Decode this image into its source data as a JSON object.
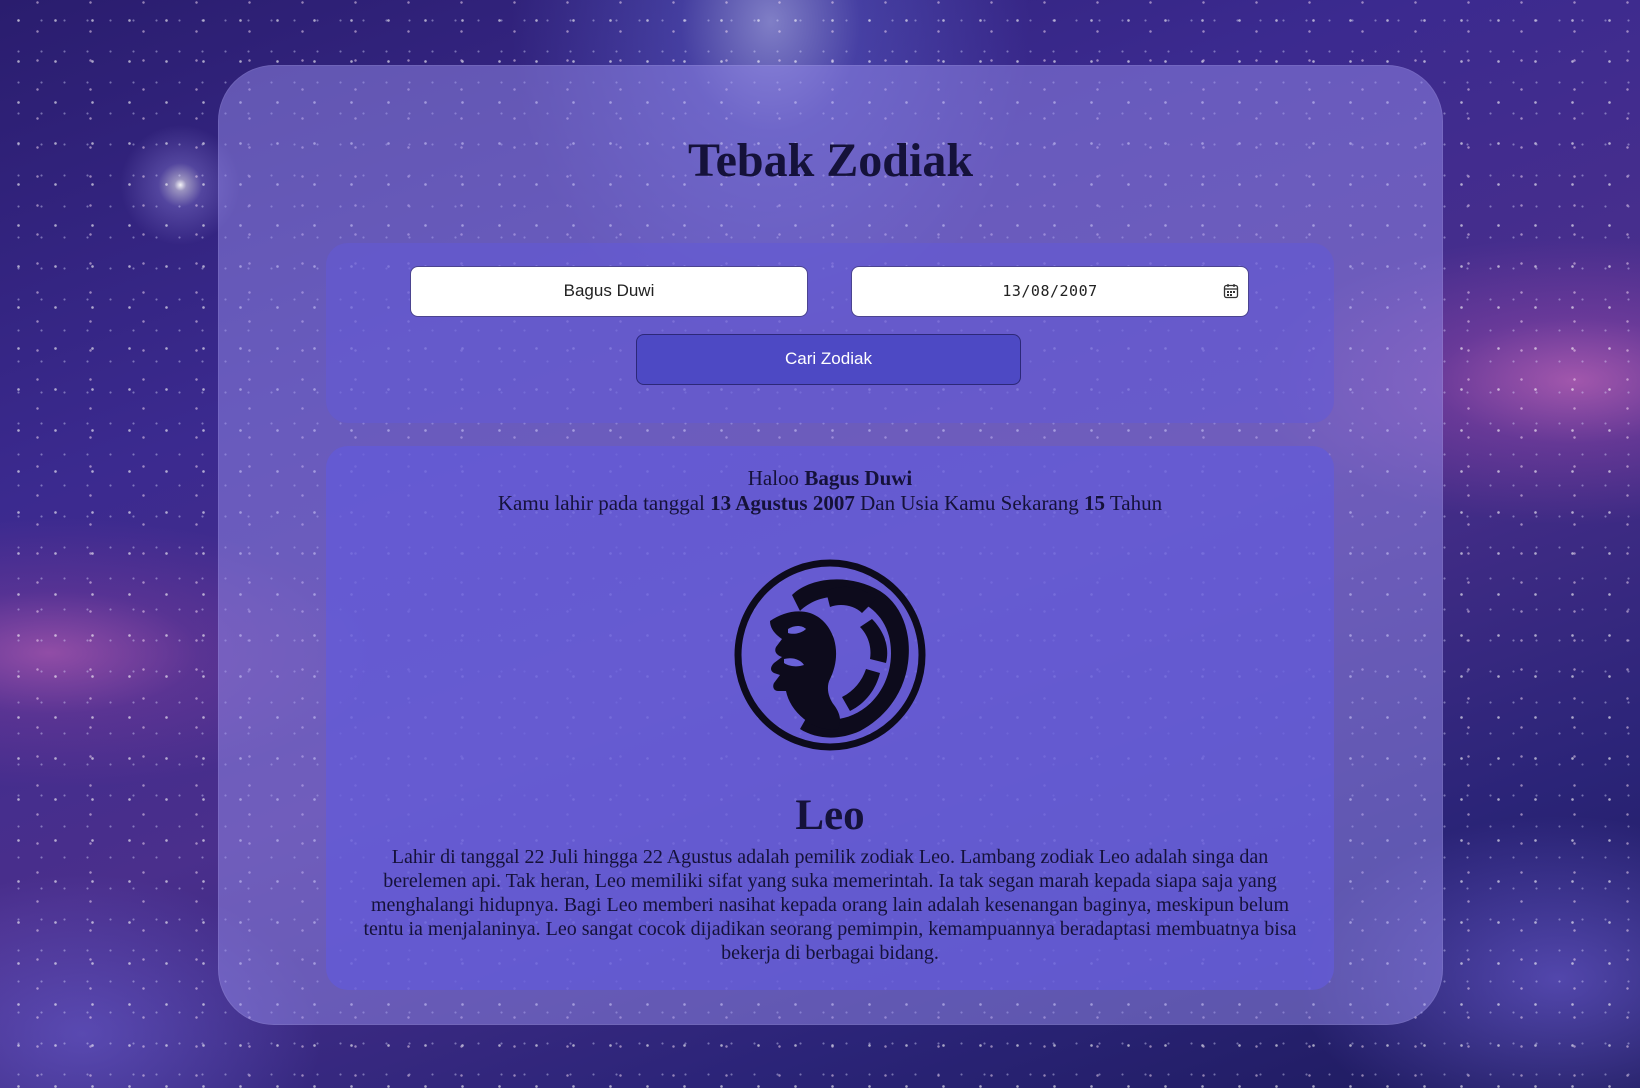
{
  "app": {
    "title": "Tebak Zodiak"
  },
  "form": {
    "name_value": "Bagus Duwi",
    "date_value": "13/08/2007",
    "submit_label": "Cari Zodiak"
  },
  "result": {
    "greeting_prefix": "Haloo",
    "name": "Bagus Duwi",
    "birth_prefix": "Kamu lahir pada tanggal",
    "birth_date": "13 Agustus 2007",
    "age_prefix": "Dan Usia Kamu Sekarang",
    "age": "15",
    "age_suffix": "Tahun",
    "zodiac_name": "Leo",
    "zodiac_icon": "leo-lion-icon",
    "description": "Lahir di tanggal 22 Juli hingga 22 Agustus adalah pemilik zodiak Leo. Lambang zodiak Leo adalah singa dan berelemen api. Tak heran, Leo memiliki sifat yang suka memerintah. Ia tak segan marah kepada siapa saja yang menghalangi hidupnya. Bagi Leo memberi nasihat kepada orang lain adalah kesenangan baginya, meskipun belum tentu ia menjalaninya. Leo sangat cocok dijadikan seorang pemimpin, kemampuannya beradaptasi membuatnya bisa bekerja di berbagai bidang."
  },
  "colors": {
    "button": "#4d49c4",
    "panel": "#625ad7",
    "text": "#15123a"
  }
}
